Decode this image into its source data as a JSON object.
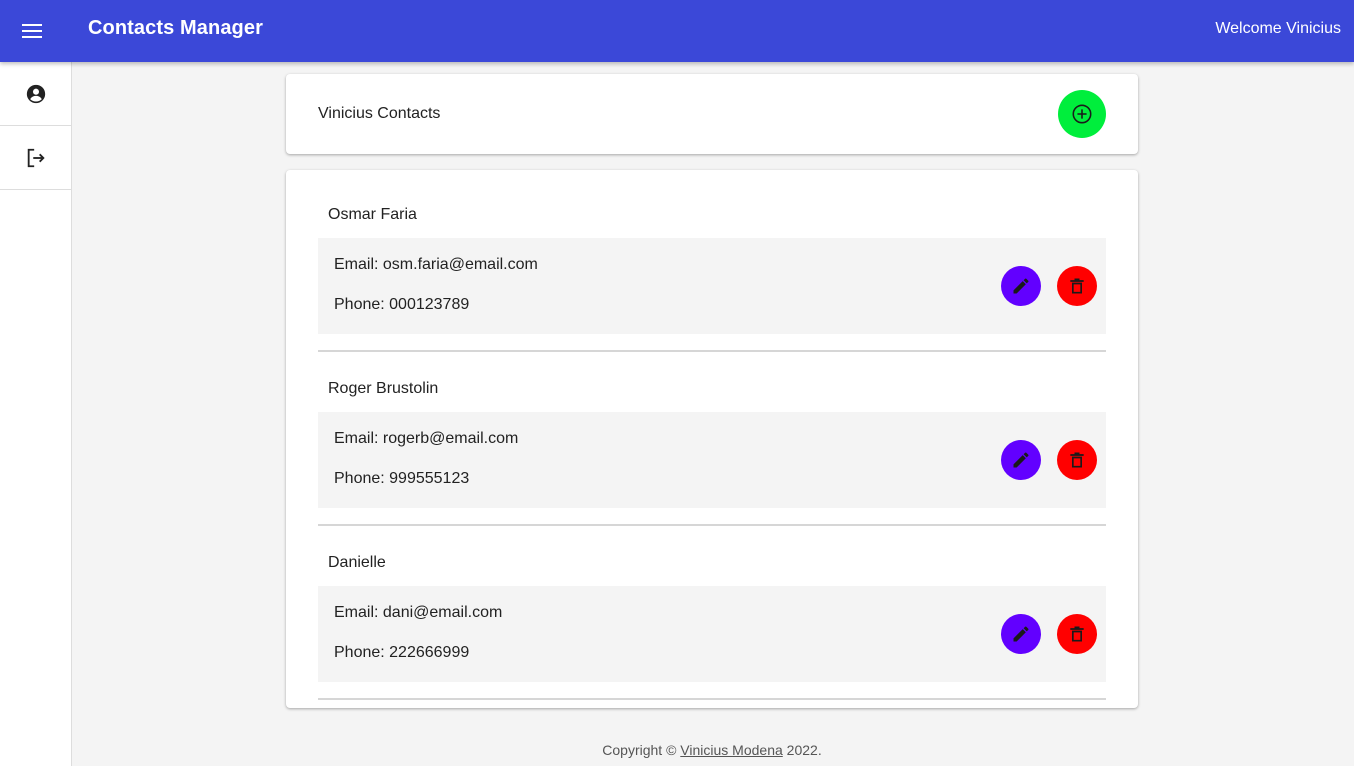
{
  "appbar": {
    "title": "Contacts Manager",
    "welcome": "Welcome Vinicius",
    "menu_icon": "menu-icon",
    "color": "#3b48d8"
  },
  "sidebar": {
    "items": [
      {
        "icon": "account-circle-icon",
        "name": "profile"
      },
      {
        "icon": "logout-icon",
        "name": "logout"
      }
    ]
  },
  "header": {
    "title": "Vinicius Contacts",
    "add_icon": "add-circle-icon",
    "add_color": "#00ee3c"
  },
  "contacts": [
    {
      "name": "Osmar Faria",
      "email": "Email: osm.faria@email.com",
      "phone": "Phone: 000123789"
    },
    {
      "name": "Roger Brustolin",
      "email": "Email: rogerb@email.com",
      "phone": "Phone: 999555123"
    },
    {
      "name": "Danielle",
      "email": "Email: dani@email.com",
      "phone": "Phone: 222666999"
    }
  ],
  "actions": {
    "edit_color": "#6200ff",
    "delete_color": "#ff0000"
  },
  "footer": {
    "prefix": "Copyright © ",
    "author": "Vinicius Modena",
    "suffix": " 2022."
  }
}
